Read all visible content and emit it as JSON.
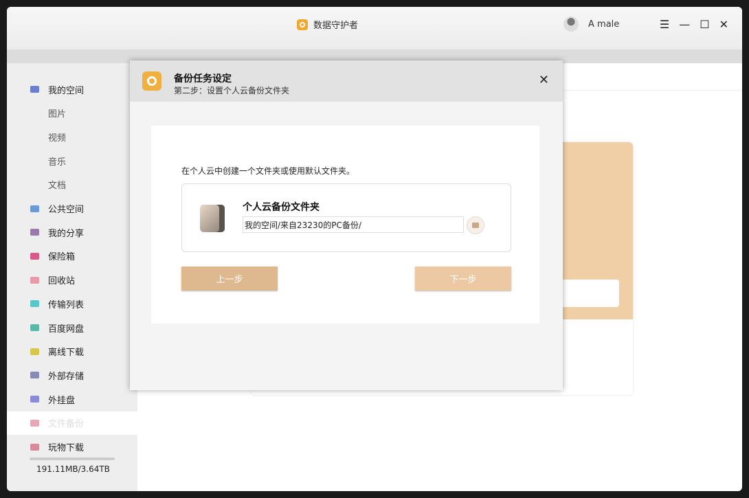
{
  "app": {
    "title": "数据守护者",
    "user": "A male"
  },
  "window_controls": {
    "menu": "☰",
    "minimize": "—",
    "maximize": "☐",
    "close": "✕"
  },
  "sidebar": {
    "items": [
      {
        "label": "我的空间",
        "color": "#6a7fd0"
      },
      {
        "label": "图片",
        "sub": true
      },
      {
        "label": "视频",
        "sub": true
      },
      {
        "label": "音乐",
        "sub": true
      },
      {
        "label": "文档",
        "sub": true
      },
      {
        "label": "公共空间",
        "color": "#6a9ad8"
      },
      {
        "label": "我的分享",
        "color": "#9a7aa8"
      },
      {
        "label": "保险箱",
        "color": "#d85a8a"
      },
      {
        "label": "回收站",
        "color": "#e89aa8"
      },
      {
        "label": "传输列表",
        "color": "#5ac8c8"
      },
      {
        "label": "百度网盘",
        "color": "#5ab8a8"
      },
      {
        "label": "离线下载",
        "color": "#d8c84a"
      },
      {
        "label": "外部存储",
        "color": "#8a8ab8"
      },
      {
        "label": "外挂盘",
        "color": "#8a8ad8"
      },
      {
        "label": "文件备份",
        "color": "#e8a8b8",
        "active": true
      },
      {
        "label": "玩物下载",
        "color": "#d88a9a"
      }
    ],
    "usage": "191.11MB/3.64TB",
    "usage_fraction": 0.0001
  },
  "dialog": {
    "title": "备份任务设定",
    "subtitle": "第二步：设置个人云备份文件夹",
    "close": "✕",
    "hint": "在个人云中创建一个文件夹或使用默认文件夹。",
    "folder_title": "个人云备份文件夹",
    "folder_path": "我的空间/来自23230的PC备份/",
    "prev_label": "上一步",
    "next_label": "下一步"
  }
}
